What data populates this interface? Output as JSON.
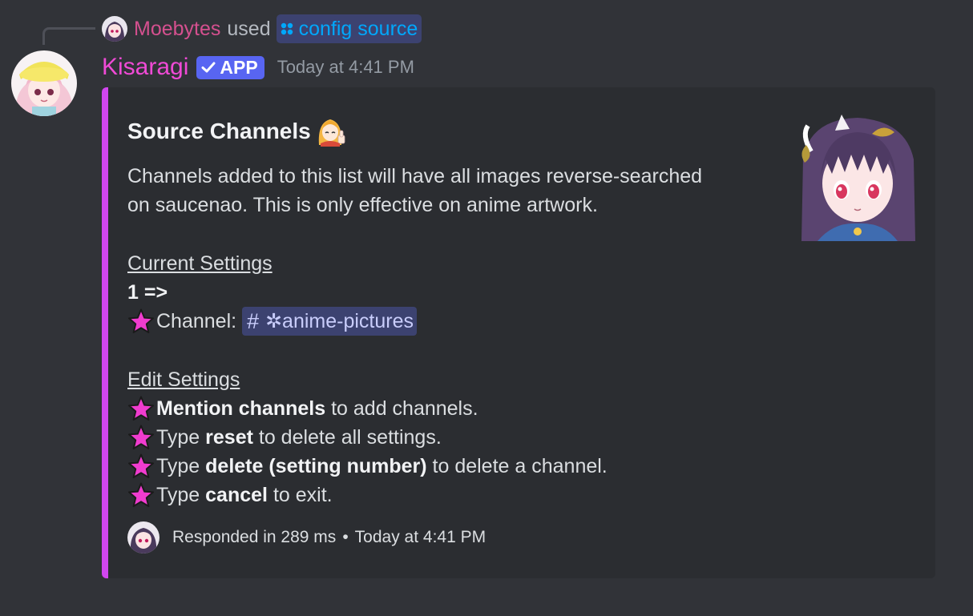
{
  "interaction": {
    "user": "Moebytes",
    "used_text": "used",
    "command": "config source",
    "user_color": "#d5508f",
    "command_color": "#00a8fc"
  },
  "message": {
    "author": "Kisaragi",
    "author_color": "#f04ad6",
    "badge": "APP",
    "timestamp": "Today at 4:41 PM"
  },
  "embed": {
    "accent_color": "#d146ef",
    "title": "Source Channels",
    "title_emoji": "anime-girl-thumbs-up-emoji",
    "description_line1": "Channels added to this list will have all images reverse-searched",
    "description_line2": "on saucenao. This is only effective on anime artwork.",
    "current_settings_heading": "Current Settings",
    "setting_index": "1 =>",
    "channel_label": "Channel:",
    "channel_hash": "#",
    "channel_name": "✲anime-pictures",
    "edit_settings_heading": "Edit Settings",
    "instructions": [
      {
        "prefix": "",
        "bold": "Mention channels",
        "suffix": " to add channels."
      },
      {
        "prefix": "Type ",
        "bold": "reset",
        "suffix": " to delete all settings."
      },
      {
        "prefix": "Type ",
        "bold": "delete (setting number)",
        "suffix": " to delete a channel."
      },
      {
        "prefix": "Type ",
        "bold": "cancel",
        "suffix": " to exit."
      }
    ],
    "footer_text": "Responded in 289 ms",
    "footer_separator": "•",
    "footer_timestamp": "Today at 4:41 PM",
    "star_color": "#f03ccf"
  }
}
